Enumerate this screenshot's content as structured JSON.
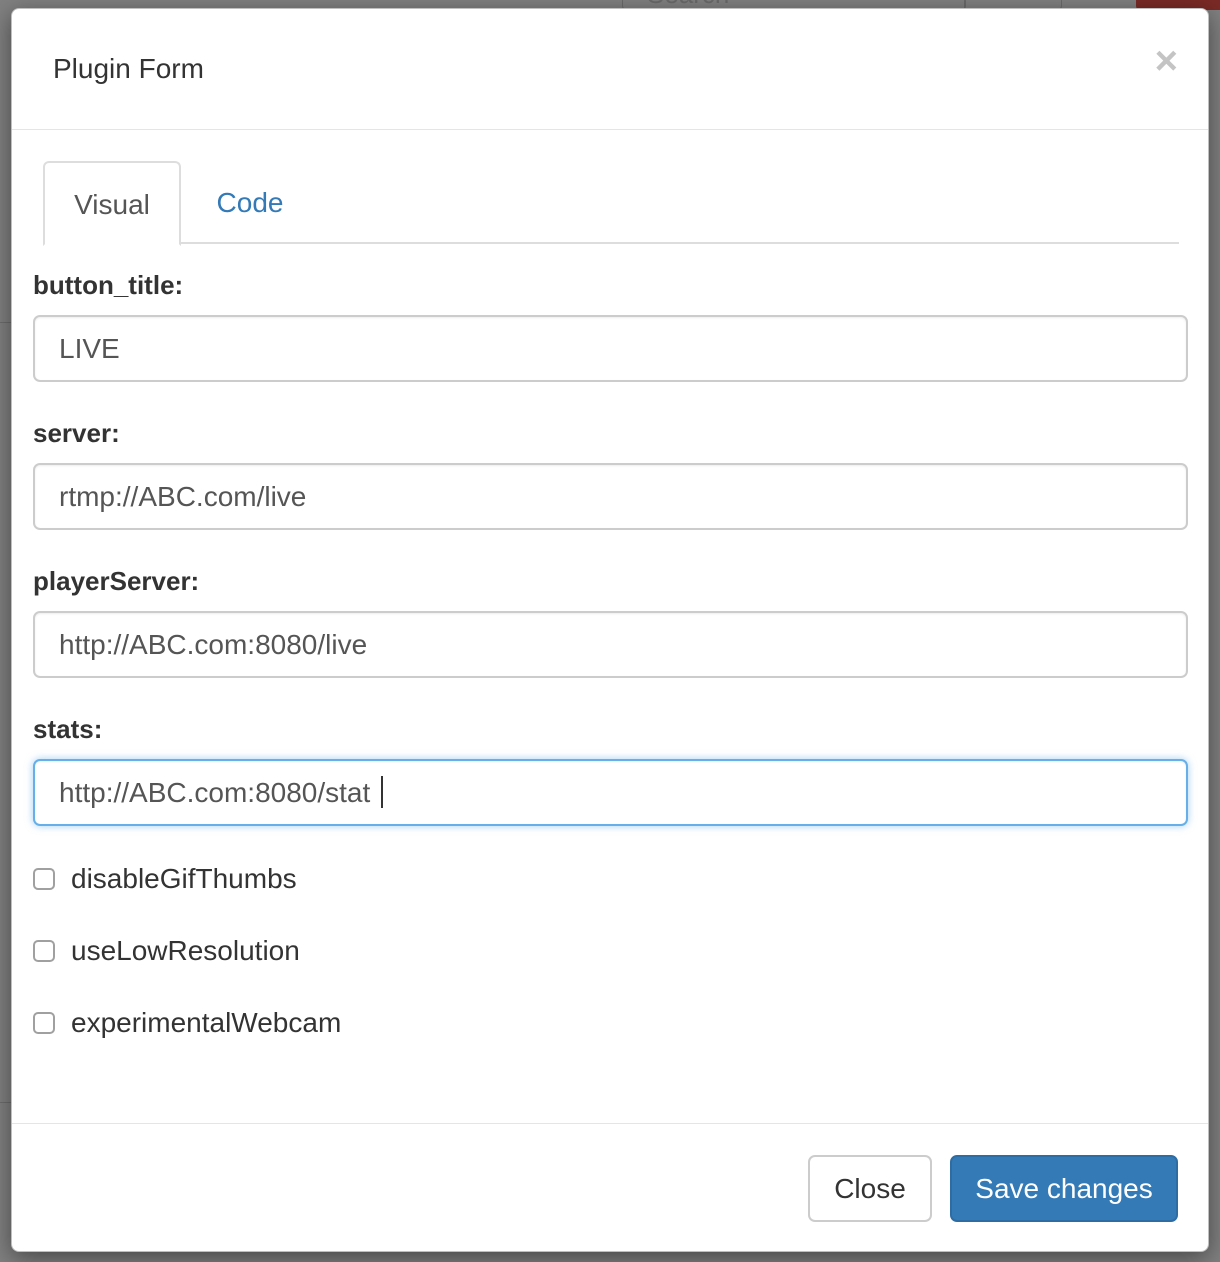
{
  "background": {
    "search_placeholder": "Search"
  },
  "modal": {
    "title": "Plugin Form",
    "close_symbol": "×",
    "tabs": [
      {
        "label": "Visual",
        "active": true
      },
      {
        "label": "Code",
        "active": false
      }
    ],
    "fields": [
      {
        "label": "button_title:",
        "value": "LIVE"
      },
      {
        "label": "server:",
        "value": "rtmp://ABC.com/live"
      },
      {
        "label": "playerServer:",
        "value": "http://ABC.com:8080/live"
      },
      {
        "label": "stats:",
        "value": "http://ABC.com:8080/stat",
        "focused": true
      }
    ],
    "checkboxes": [
      {
        "label": "disableGifThumbs",
        "checked": false
      },
      {
        "label": "useLowResolution",
        "checked": false
      },
      {
        "label": "experimentalWebcam",
        "checked": false
      }
    ],
    "footer": {
      "close_label": "Close",
      "save_label": "Save changes"
    }
  },
  "colors": {
    "primary": "#337ab7",
    "focus_border": "#66afe9",
    "overlay": "#808080"
  }
}
